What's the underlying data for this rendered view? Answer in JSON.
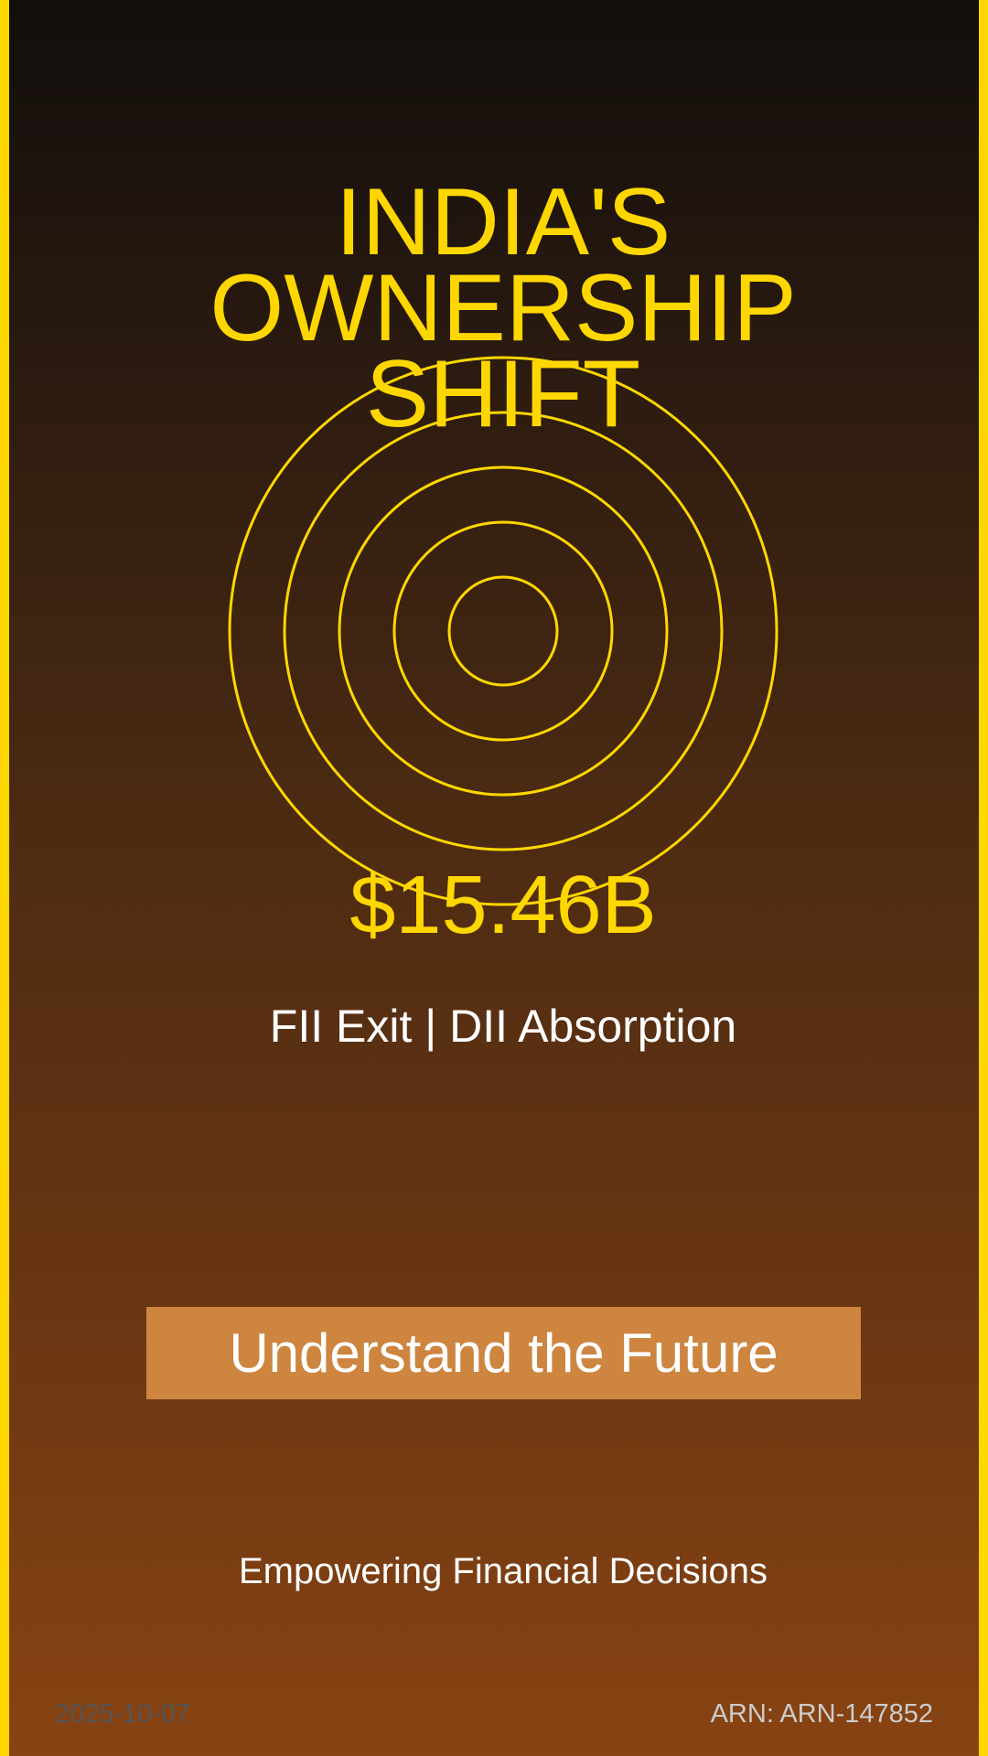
{
  "title": {
    "line1": "INDIA'S",
    "line2": "OWNERSHIP",
    "line3": "SHIFT"
  },
  "amount": "$15.46B",
  "subtitle": "FII Exit | DII Absorption",
  "cta_label": "Understand the Future",
  "tagline": "Empowering Financial Decisions",
  "footer": {
    "date": "2025-10-07",
    "arn": "ARN: ARN-147852"
  },
  "colors": {
    "accent": "#FFD700",
    "button": "#CD853F",
    "background_top": "#110e0c",
    "background_bottom": "#884312"
  }
}
